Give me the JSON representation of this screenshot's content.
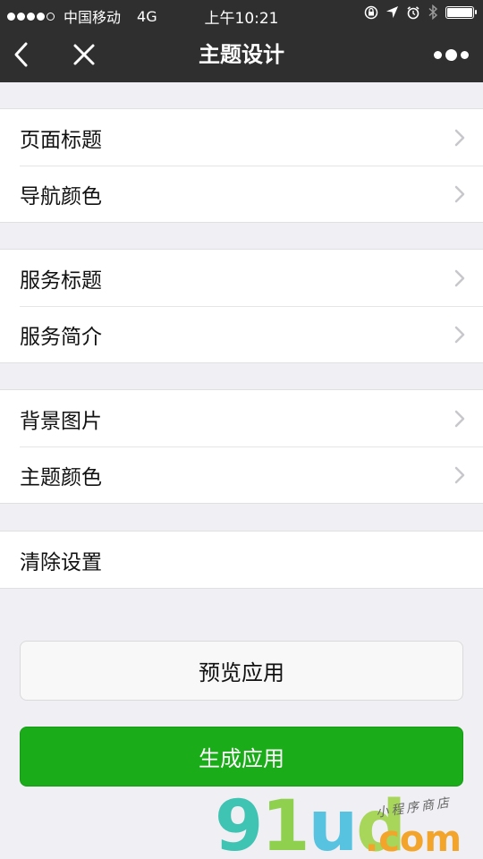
{
  "status_bar": {
    "carrier": "中国移动",
    "network": "4G",
    "time": "上午10:21",
    "battery_level": 0.95
  },
  "navbar": {
    "title": "主题设计",
    "back_icon": "chevron-left-icon",
    "close_icon": "close-icon",
    "more_icon": "more-dots-icon"
  },
  "groups": [
    {
      "items": [
        {
          "label": "页面标题",
          "chevron": true
        },
        {
          "label": "导航颜色",
          "chevron": true
        }
      ]
    },
    {
      "items": [
        {
          "label": "服务标题",
          "chevron": true
        },
        {
          "label": "服务简介",
          "chevron": true
        }
      ]
    },
    {
      "items": [
        {
          "label": "背景图片",
          "chevron": true
        },
        {
          "label": "主题颜色",
          "chevron": true
        }
      ]
    },
    {
      "items": [
        {
          "label": "清除设置",
          "chevron": false
        }
      ]
    }
  ],
  "buttons": {
    "preview": "预览应用",
    "generate": "生成应用"
  },
  "watermark": {
    "logo": "91ud",
    "domain": ".com",
    "tagline": "小程序商店"
  },
  "colors": {
    "header_bg": "#2f2f2f",
    "primary_green": "#1aad19",
    "page_bg": "#efeff4"
  }
}
